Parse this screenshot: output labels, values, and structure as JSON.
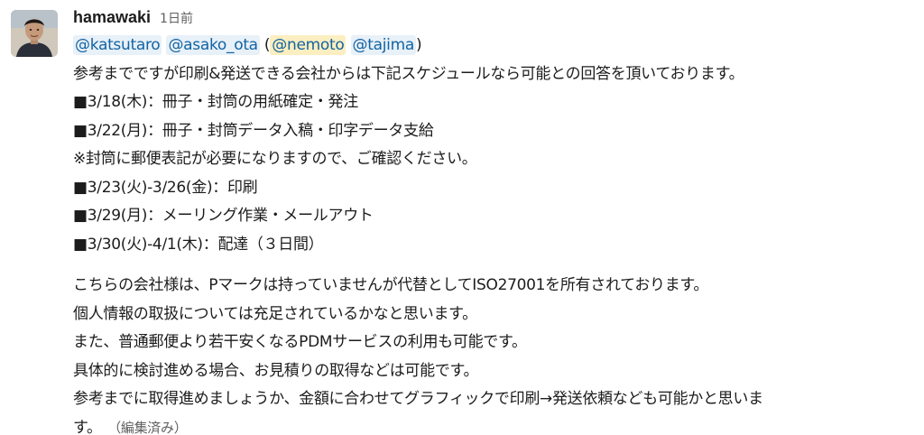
{
  "message": {
    "username": "hamawaki",
    "timestamp": "1日前",
    "mentions": {
      "m1": "@katsutaro",
      "m2": "@asako_ota",
      "open_paren": "(",
      "m3": "@nemoto",
      "m4": "@tajima",
      "close_paren": ")"
    },
    "lines1": [
      "参考までですが印刷&発送できる会社からは下記スケジュールなら可能との回答を頂いております。",
      "■3/18(木)：冊子・封筒の用紙確定・発注",
      "■3/22(月)：冊子・封筒データ入稿・印字データ支給",
      "※封筒に郵便表記が必要になりますので、ご確認ください。",
      "■3/23(火)-3/26(金)：印刷",
      "■3/29(月)：メーリング作業・メールアウト",
      "■3/30(火)-4/1(木)：配達（３日間）"
    ],
    "lines2": [
      "こちらの会社様は、Pマークは持っていませんが代替としてISO27001を所有されております。",
      "個人情報の取扱については充足されているかなと思います。",
      "また、普通郵便より若干安くなるPDMサービスの利用も可能です。",
      "具体的に検討進める場合、お見積りの取得などは可能です。",
      "参考までに取得進めましょうか、金額に合わせてグラフィックで印刷→発送依頼なども可能かと思いま"
    ],
    "last_line": "す。",
    "edited_label": "（編集済み）"
  }
}
